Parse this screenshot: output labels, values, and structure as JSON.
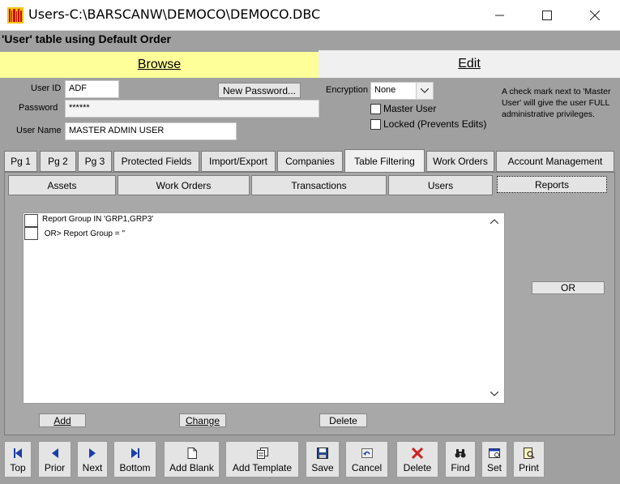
{
  "window": {
    "title": "Users-C:\\BARSCANW\\DEMOCO\\DEMOCO.DBC",
    "minimize": "—",
    "maximize": "☐",
    "close": "✕"
  },
  "caption": "'User' table using Default Order",
  "mode_tabs": {
    "browse": "Browse",
    "edit": "Edit"
  },
  "form": {
    "user_id_label": "User ID",
    "user_id_value": "ADF",
    "password_label": "Password",
    "password_value": "******",
    "user_name_label": "User Name",
    "user_name_value": "MASTER ADMIN USER",
    "new_password_button": "New Password...",
    "encryption_label": "Encryption",
    "encryption_value": "None",
    "master_user_label": "Master User",
    "locked_label": "Locked (Prevents Edits)",
    "help_text": "A check mark next to 'Master User' will give the user FULL administrative privileges."
  },
  "tabs": [
    "Pg 1",
    "Pg 2",
    "Pg 3",
    "Protected Fields",
    "Import/Export",
    "Companies",
    "Table Filtering",
    "Work Orders",
    "Account Management"
  ],
  "active_tab": "Table Filtering",
  "subtabs": [
    "Assets",
    "Work Orders",
    "Transactions",
    "Users",
    "Reports"
  ],
  "active_subtab": "Reports",
  "filters": [
    {
      "text": "Report Group IN 'GRP1,GRP3'"
    },
    {
      "text": " OR> Report Group = ''"
    }
  ],
  "filter_buttons": {
    "add": "Add",
    "change": "Change",
    "delete": "Delete",
    "or": "OR"
  },
  "toolbar": {
    "top": "Top",
    "prior": "Prior",
    "next": "Next",
    "bottom": "Bottom",
    "add_blank": "Add Blank",
    "add_template": "Add Template",
    "save": "Save",
    "cancel": "Cancel",
    "delete": "Delete",
    "find": "Find",
    "set": "Set",
    "print": "Print"
  },
  "colors": {
    "browse_tab": "#ffff99",
    "window_bg": "#a0a0a0",
    "delete_icon": "#cc2222",
    "nav_icon": "#1a3fa8"
  }
}
